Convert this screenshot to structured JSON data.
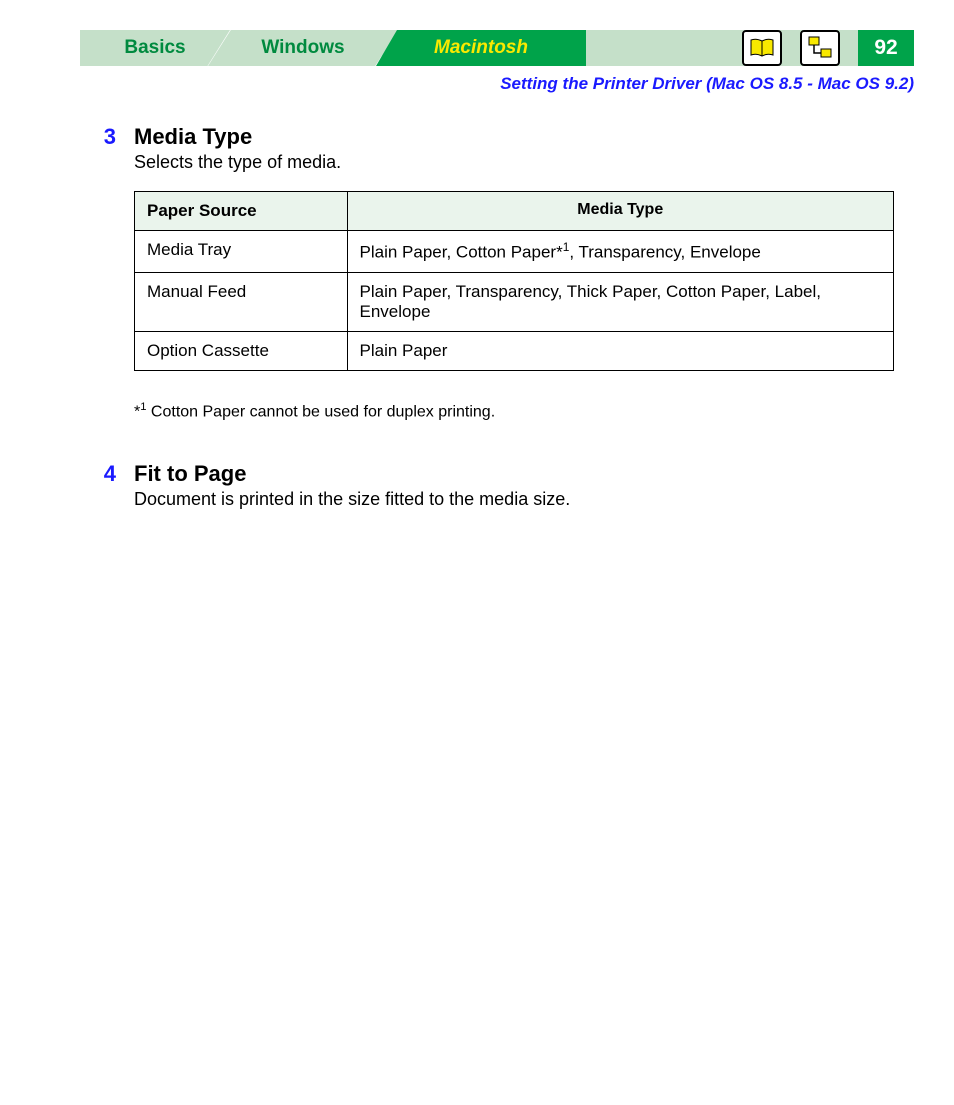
{
  "tabs": {
    "basics": "Basics",
    "windows": "Windows",
    "macintosh": "Macintosh"
  },
  "page_number": "92",
  "breadcrumb": "Setting the Printer Driver (Mac OS 8.5 - Mac OS 9.2)",
  "step3": {
    "num": "3",
    "title": "Media Type",
    "desc": "Selects the type of media."
  },
  "table": {
    "th1": "Paper Source",
    "th2": "Media Type",
    "rows": [
      {
        "src": "Media Tray",
        "mt_pre": "Plain Paper, Cotton Paper*",
        "mt_sup": "1",
        "mt_post": ", Transparency, Envelope"
      },
      {
        "src": "Manual Feed",
        "mt_pre": "Plain Paper, Transparency, Thick Paper, Cotton Paper, Label, Envelope",
        "mt_sup": "",
        "mt_post": ""
      },
      {
        "src": "Option Cassette",
        "mt_pre": "Plain Paper",
        "mt_sup": "",
        "mt_post": ""
      }
    ]
  },
  "footnote": {
    "prefix": "*",
    "sup": "1",
    "text": " Cotton Paper cannot be used for duplex printing."
  },
  "step4": {
    "num": "4",
    "title": "Fit to Page",
    "desc": "Document is printed in the size fitted to the media size."
  }
}
